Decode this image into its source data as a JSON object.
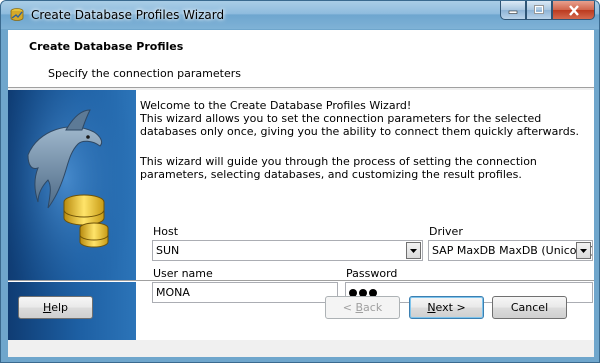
{
  "window": {
    "title": "Create Database Profiles Wizard",
    "icons": {
      "app": "database-wizard-icon",
      "minimize": "minimize-icon",
      "maximize": "maximize-icon",
      "close": "close-icon"
    }
  },
  "header": {
    "title": "Create Database Profiles",
    "subtitle": "Specify the connection parameters"
  },
  "intro": {
    "paragraph1": "Welcome to the Create Database Profiles Wizard!\nThis wizard allows you to set the connection parameters for the selected databases only once, giving you the ability to connect them quickly afterwards.",
    "paragraph2": "This wizard will guide you through the process of setting the connection parameters, selecting databases, and customizing the result profiles."
  },
  "form": {
    "host_label": "Host",
    "host_value": "SUN",
    "driver_label": "Driver",
    "driver_value": "SAP MaxDB MaxDB (Unicode)",
    "username_label": "User name",
    "username_value": "MONA",
    "password_label": "Password",
    "password_length": 3
  },
  "buttons": {
    "help": {
      "pre": "",
      "key": "H",
      "post": "elp"
    },
    "back": {
      "pre": "< ",
      "key": "B",
      "post": "ack"
    },
    "next": {
      "pre": "",
      "key": "N",
      "post": "ext >"
    },
    "cancel": "Cancel"
  },
  "colors": {
    "banner": "#1d5fa3",
    "titlebar": "#8fbcde",
    "default_button_border": "#3c7fb1"
  }
}
